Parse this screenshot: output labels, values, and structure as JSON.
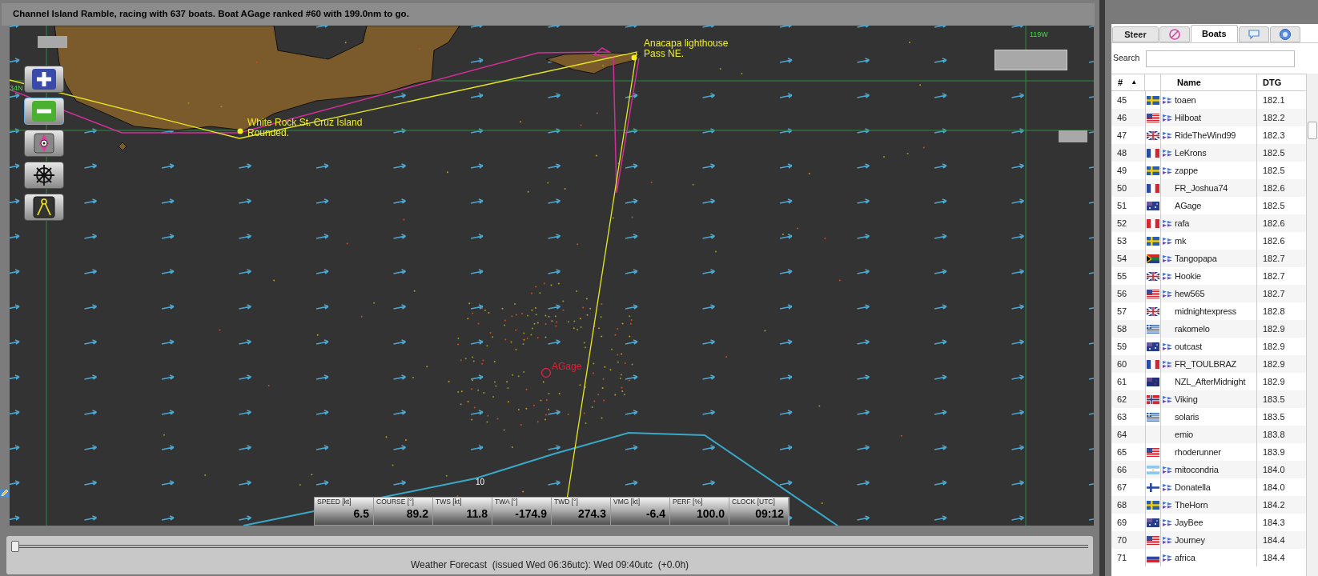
{
  "title": "Channel Island Ramble, racing with 637 boats. Boat AGage ranked #60 with 199.0nm to go.",
  "map": {
    "grid_labels": [
      "34N",
      "119W"
    ],
    "marks": [
      {
        "lines": [
          "White Rock St. Cruz Island",
          "Rounded."
        ]
      },
      {
        "lines": [
          "Anacapa lighthouse",
          "Pass NE."
        ]
      }
    ],
    "boat_label": "AGage",
    "isoline_label": "10"
  },
  "instruments": [
    {
      "label": "SPEED [kt]",
      "value": "6.5"
    },
    {
      "label": "COURSE [°]",
      "value": "89.2"
    },
    {
      "label": "TWS [kt]",
      "value": "11.8"
    },
    {
      "label": "TWA [°]",
      "value": "-174.9"
    },
    {
      "label": "TWD [°]",
      "value": "274.3"
    },
    {
      "label": "VMG [kt]",
      "value": "-6.4"
    },
    {
      "label": "PERF [%]",
      "value": "100.0"
    },
    {
      "label": "CLOCK [UTC]",
      "value": "09:12"
    }
  ],
  "timeline": {
    "level": 0,
    "text": "Weather Forecast  (issued Wed 06:36utc): Wed 09:40utc  (+0.0h)"
  },
  "panel": {
    "tabs": [
      {
        "kind": "text",
        "label": "Steer",
        "selected": false
      },
      {
        "kind": "compass",
        "selected": false
      },
      {
        "kind": "text",
        "label": "Boats",
        "selected": true
      },
      {
        "kind": "chat",
        "selected": false
      },
      {
        "kind": "help",
        "selected": false
      }
    ],
    "search": {
      "label": "Search"
    },
    "columns": {
      "rank": "#",
      "sort": "▲",
      "name": "Name",
      "dtg": "DTG"
    },
    "rows": [
      {
        "rank": "45",
        "kind": "se",
        "boat_icon": true,
        "name": "toaen",
        "dtg": "182.1"
      },
      {
        "rank": "46",
        "kind": "us",
        "boat_icon": true,
        "name": "Hilboat",
        "dtg": "182.2"
      },
      {
        "rank": "47",
        "kind": "gb",
        "boat_icon": true,
        "name": "RideTheWind99",
        "dtg": "182.3"
      },
      {
        "rank": "48",
        "kind": "fr",
        "boat_icon": true,
        "name": "LeKrons",
        "dtg": "182.5"
      },
      {
        "rank": "49",
        "kind": "se",
        "boat_icon": true,
        "name": "zappe",
        "dtg": "182.5"
      },
      {
        "rank": "50",
        "kind": "fr",
        "boat_icon": false,
        "name": "FR_Joshua74",
        "dtg": "182.6"
      },
      {
        "rank": "51",
        "kind": "au",
        "boat_icon": false,
        "name": "AGage",
        "dtg": "182.5"
      },
      {
        "rank": "52",
        "kind": "pe",
        "boat_icon": true,
        "name": "rafa",
        "dtg": "182.6"
      },
      {
        "rank": "53",
        "kind": "se",
        "boat_icon": true,
        "name": "mk",
        "dtg": "182.6"
      },
      {
        "rank": "54",
        "kind": "za",
        "boat_icon": true,
        "name": "Tangopapa",
        "dtg": "182.7"
      },
      {
        "rank": "55",
        "kind": "gb",
        "boat_icon": true,
        "name": "Hookie",
        "dtg": "182.7"
      },
      {
        "rank": "56",
        "kind": "us",
        "boat_icon": true,
        "name": "hew565",
        "dtg": "182.7"
      },
      {
        "rank": "57",
        "kind": "gb",
        "boat_icon": false,
        "name": "midnightexpress",
        "dtg": "182.8"
      },
      {
        "rank": "58",
        "kind": "gr",
        "boat_icon": false,
        "name": "rakomelo",
        "dtg": "182.9"
      },
      {
        "rank": "59",
        "kind": "au",
        "boat_icon": true,
        "name": "outcast",
        "dtg": "182.9"
      },
      {
        "rank": "60",
        "kind": "fr",
        "boat_icon": true,
        "name": "FR_TOULBRAZ",
        "dtg": "182.9"
      },
      {
        "rank": "61",
        "kind": "nz",
        "boat_icon": false,
        "name": "NZL_AfterMidnight",
        "dtg": "182.9"
      },
      {
        "rank": "62",
        "kind": "no",
        "boat_icon": true,
        "name": "Viking",
        "dtg": "183.5"
      },
      {
        "rank": "63",
        "kind": "gr",
        "boat_icon": false,
        "name": "solaris",
        "dtg": "183.5"
      },
      {
        "rank": "64",
        "kind": "none",
        "boat_icon": false,
        "name": "emio",
        "dtg": "183.8"
      },
      {
        "rank": "65",
        "kind": "us",
        "boat_icon": false,
        "name": "rhoderunner",
        "dtg": "183.9"
      },
      {
        "rank": "66",
        "kind": "ar",
        "boat_icon": true,
        "name": "mitocondria",
        "dtg": "184.0"
      },
      {
        "rank": "67",
        "kind": "fi",
        "boat_icon": true,
        "name": "Donatella",
        "dtg": "184.0"
      },
      {
        "rank": "68",
        "kind": "se",
        "boat_icon": true,
        "name": "TheHorn",
        "dtg": "184.2"
      },
      {
        "rank": "69",
        "kind": "au",
        "boat_icon": true,
        "name": "JayBee",
        "dtg": "184.3"
      },
      {
        "rank": "70",
        "kind": "us",
        "boat_icon": true,
        "name": "Journey",
        "dtg": "184.4"
      },
      {
        "rank": "71",
        "kind": "si",
        "boat_icon": true,
        "name": "africa",
        "dtg": "184.4"
      }
    ]
  }
}
